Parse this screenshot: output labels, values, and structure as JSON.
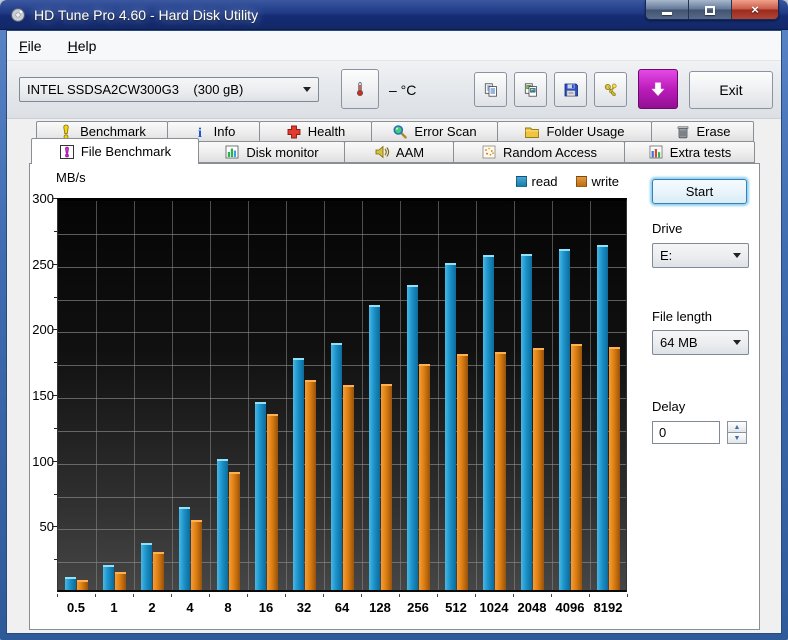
{
  "window": {
    "title": "HD Tune Pro 4.60 - Hard Disk Utility",
    "caption_buttons": [
      "minimize",
      "maximize",
      "close"
    ]
  },
  "menu": {
    "items": [
      "File",
      "Help"
    ]
  },
  "toolbar": {
    "drive_combo": {
      "value": "INTEL SSDSA2CW300G3    (300 gB)"
    },
    "temperature_label": "– °C",
    "buttons": [
      {
        "name": "copy-text-button",
        "icon": "copy-text-icon"
      },
      {
        "name": "copy-image-button",
        "icon": "copy-image-icon"
      },
      {
        "name": "save-button",
        "icon": "save-icon"
      },
      {
        "name": "options-button",
        "icon": "keys-icon"
      },
      {
        "name": "update-button",
        "icon": "down-arrow-icon",
        "accent": "#bb1cbb"
      }
    ],
    "exit_label": "Exit"
  },
  "tabs": {
    "active": "File Benchmark",
    "row1": [
      {
        "label": "Benchmark",
        "icon": "benchmark-icon"
      },
      {
        "label": "Info",
        "icon": "info-icon"
      },
      {
        "label": "Health",
        "icon": "health-icon"
      },
      {
        "label": "Error Scan",
        "icon": "error-scan-icon"
      },
      {
        "label": "Folder Usage",
        "icon": "folder-icon"
      },
      {
        "label": "Erase",
        "icon": "erase-icon"
      }
    ],
    "row2": [
      {
        "label": "File Benchmark",
        "icon": "file-benchmark-icon"
      },
      {
        "label": "Disk monitor",
        "icon": "disk-monitor-icon"
      },
      {
        "label": "AAM",
        "icon": "aam-icon"
      },
      {
        "label": "Random Access",
        "icon": "random-access-icon"
      },
      {
        "label": "Extra tests",
        "icon": "extra-tests-icon"
      }
    ]
  },
  "controls": {
    "start_label": "Start",
    "drive": {
      "label": "Drive",
      "value": "E:"
    },
    "file_length": {
      "label": "File length",
      "value": "64 MB"
    },
    "delay": {
      "label": "Delay",
      "value": "0"
    }
  },
  "colors": {
    "read": "#1b92c9",
    "write": "#dd7f12",
    "titlebar": "#16307c",
    "update_button": "#bb1cbb"
  },
  "chart_data": {
    "type": "bar",
    "title": "",
    "ylabel": "MB/s",
    "xlabel": "",
    "categories": [
      "0.5",
      "1",
      "2",
      "4",
      "8",
      "16",
      "32",
      "64",
      "128",
      "256",
      "512",
      "1024",
      "2048",
      "4096",
      "8192"
    ],
    "series": [
      {
        "name": "read",
        "color": "#1b92c9",
        "values": [
          10,
          19,
          36,
          63,
          100,
          143,
          177,
          188,
          217,
          232,
          249,
          255,
          256,
          260,
          263
        ]
      },
      {
        "name": "write",
        "color": "#dd7f12",
        "values": [
          8,
          14,
          29,
          53,
          90,
          134,
          160,
          156,
          157,
          172,
          180,
          181,
          184,
          187,
          185
        ]
      }
    ],
    "ylim": [
      0,
      300
    ],
    "grid_step": 25,
    "label_step": 50,
    "grid": true,
    "legend_position": "top-right"
  }
}
